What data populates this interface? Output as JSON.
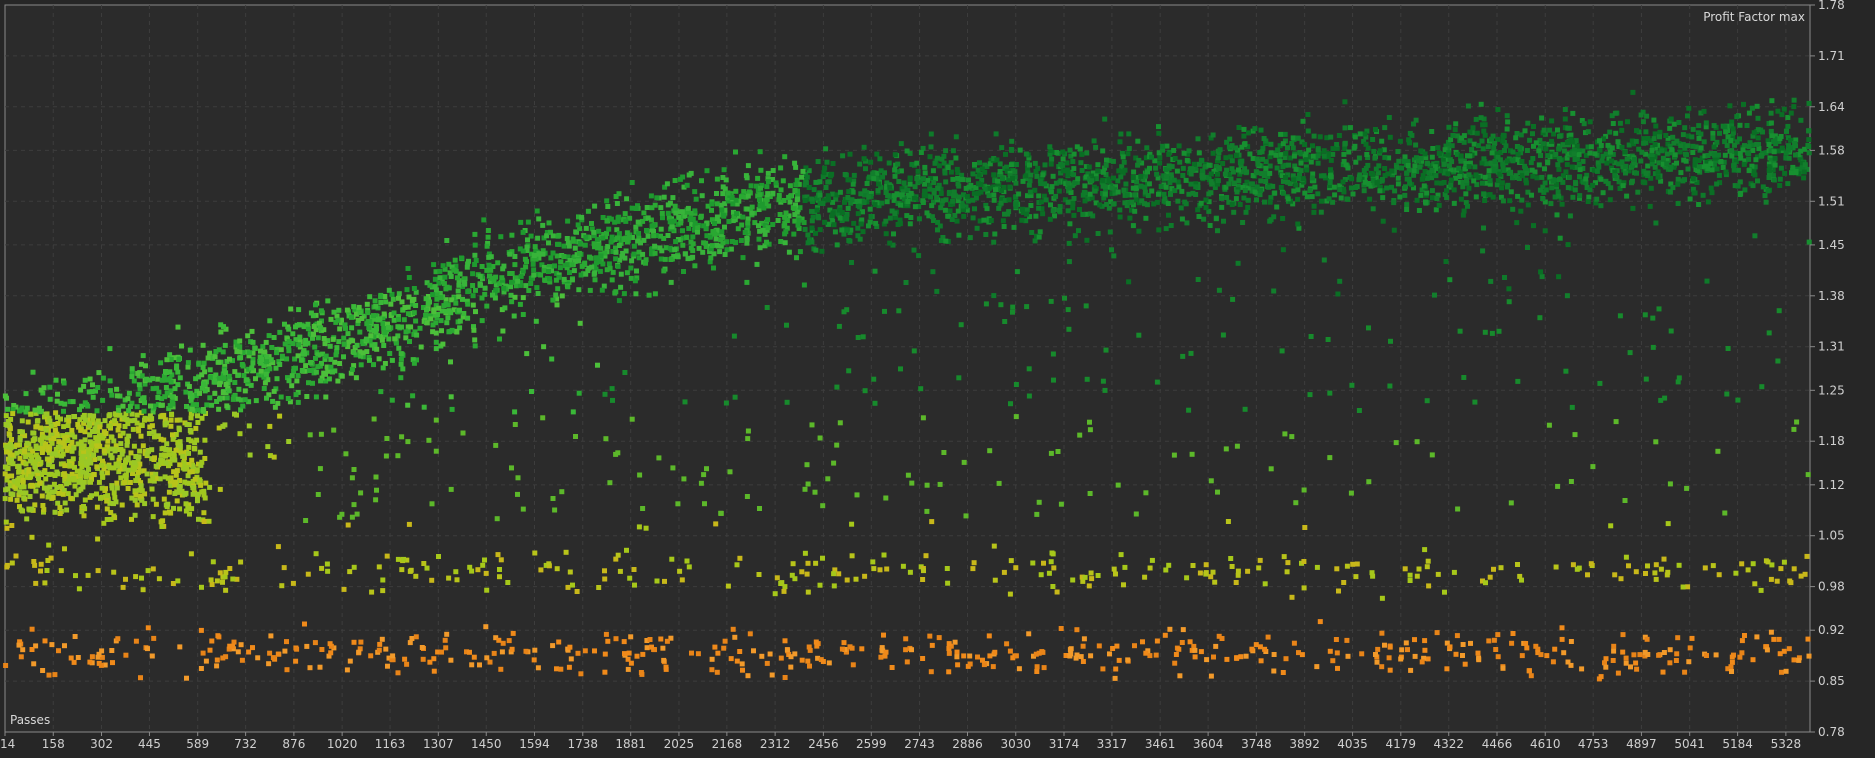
{
  "chart_data": {
    "type": "scatter",
    "title": "",
    "ylabel": "Profit Factor max",
    "xlabel": "Passes",
    "xlim": [
      14,
      5400
    ],
    "ylim": [
      0.78,
      1.78
    ],
    "x_ticks": [
      "14",
      "158",
      "302",
      "445",
      "589",
      "732",
      "876",
      "1020",
      "1163",
      "1307",
      "1450",
      "1594",
      "1738",
      "1881",
      "2025",
      "2168",
      "2312",
      "2456",
      "2599",
      "2743",
      "2886",
      "3030",
      "3174",
      "3317",
      "3461",
      "3604",
      "3748",
      "3892",
      "4035",
      "4179",
      "4322",
      "4466",
      "4610",
      "4753",
      "4897",
      "5041",
      "5184",
      "5328"
    ],
    "y_ticks": [
      "1.78",
      "1.71",
      "1.64",
      "1.58",
      "1.51",
      "1.45",
      "1.38",
      "1.31",
      "1.25",
      "1.18",
      "1.12",
      "1.05",
      "0.98",
      "0.92",
      "0.85",
      "0.78"
    ],
    "grid": true,
    "point_color_scale": [
      "#f08a1a",
      "#c8b81a",
      "#8cc81a",
      "#2ab83a",
      "#0e7a2a"
    ],
    "trend_description_points": [
      {
        "x": 14,
        "y": 1.18
      },
      {
        "x": 302,
        "y": 1.2
      },
      {
        "x": 589,
        "y": 1.25
      },
      {
        "x": 876,
        "y": 1.3
      },
      {
        "x": 1163,
        "y": 1.34
      },
      {
        "x": 1450,
        "y": 1.4
      },
      {
        "x": 1738,
        "y": 1.44
      },
      {
        "x": 2025,
        "y": 1.48
      },
      {
        "x": 2599,
        "y": 1.52
      },
      {
        "x": 3174,
        "y": 1.53
      },
      {
        "x": 3748,
        "y": 1.55
      },
      {
        "x": 4322,
        "y": 1.56
      },
      {
        "x": 4897,
        "y": 1.57
      },
      {
        "x": 5328,
        "y": 1.58
      }
    ],
    "bands": [
      {
        "name": "low",
        "ymin": 0.83,
        "ymax": 0.95,
        "color": "#f08a1a"
      },
      {
        "name": "mid",
        "ymin": 0.95,
        "ymax": 1.07,
        "color": "#b8c41a"
      }
    ]
  }
}
